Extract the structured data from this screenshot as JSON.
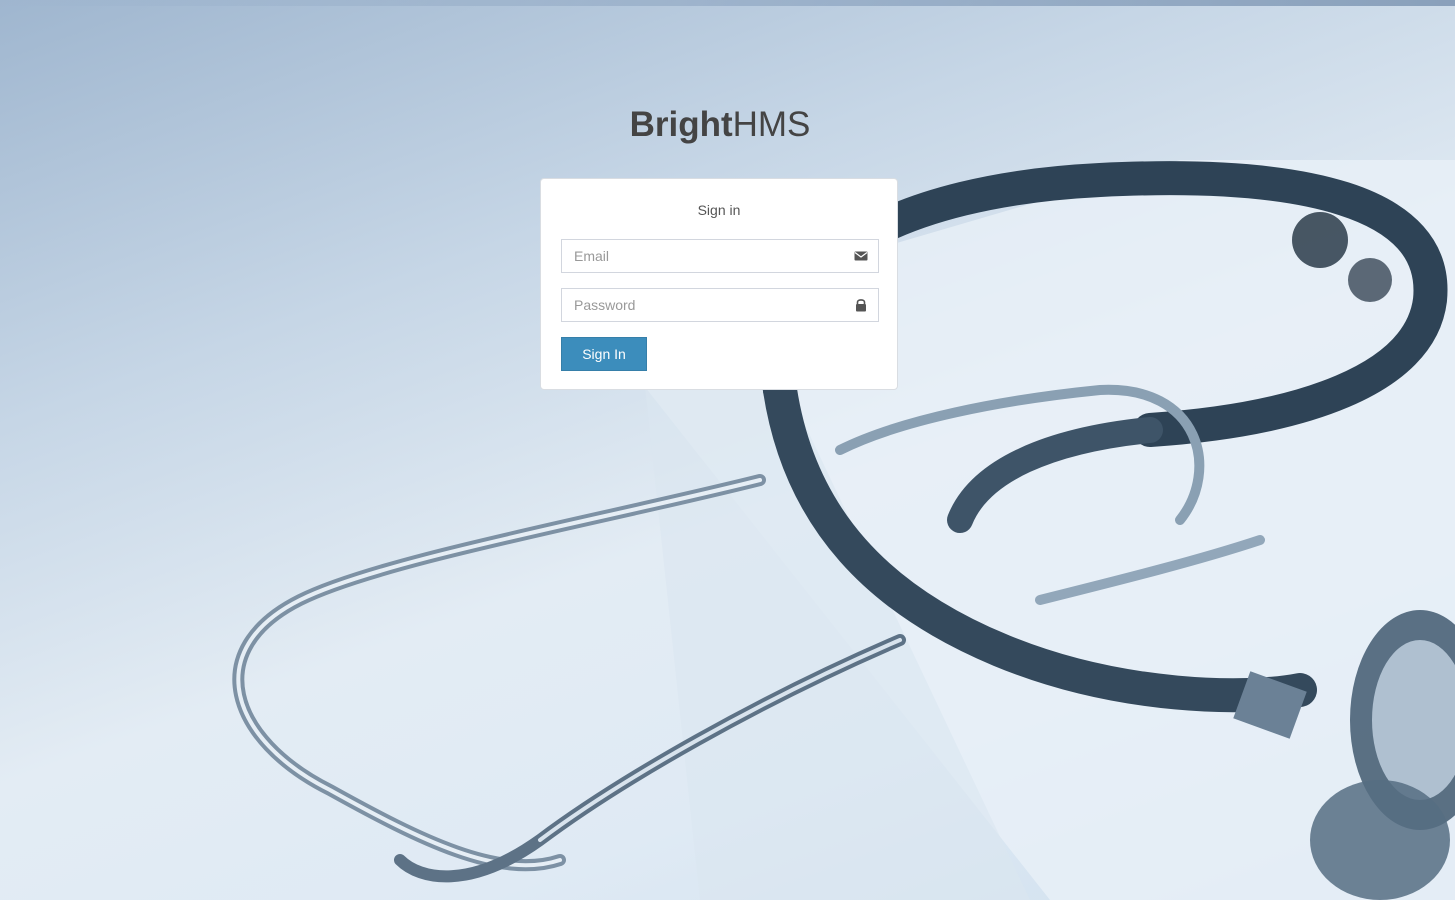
{
  "logo": {
    "bold": "Bright",
    "light": "HMS"
  },
  "login": {
    "message": "Sign in",
    "email_placeholder": "Email",
    "password_placeholder": "Password",
    "submit_label": "Sign In"
  },
  "icons": {
    "email": "envelope-icon",
    "password": "lock-icon"
  },
  "colors": {
    "button": "#3c8dbc",
    "logo_text": "#444444"
  }
}
